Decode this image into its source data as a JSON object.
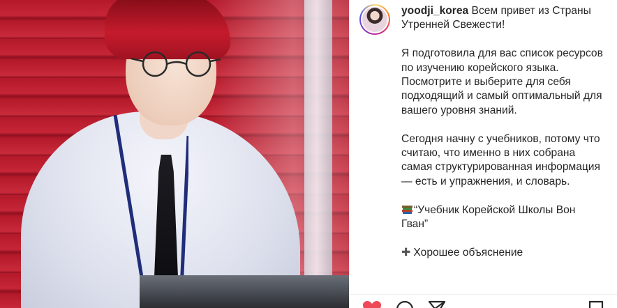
{
  "post": {
    "username": "yoodji_korea",
    "caption_lines": {
      "intro": "Всем привет из Страны Утренней Свежести!",
      "p1": "Я подготовила для вас список ресурсов по изучению корейского языка. Посмотрите и выберите для себя подходящий и самый оптимальный для вашего уровня знаний.",
      "p2": "Сегодня начну с учебников, потому что считаю, что именно в них собрана самая структурированная информация — есть и упражнения, и словарь.",
      "p3": "“Учебник Корейской Школы Вон Гван”",
      "p4_partial": "Хорошее объяснение"
    },
    "icons": {
      "book": "books-icon",
      "plus": "plus-icon",
      "like": "heart-icon",
      "comment": "comment-icon",
      "share": "share-icon",
      "save": "bookmark-icon"
    },
    "colors": {
      "like_red": "#ed4956",
      "text": "#262626",
      "border": "#efefef"
    }
  }
}
